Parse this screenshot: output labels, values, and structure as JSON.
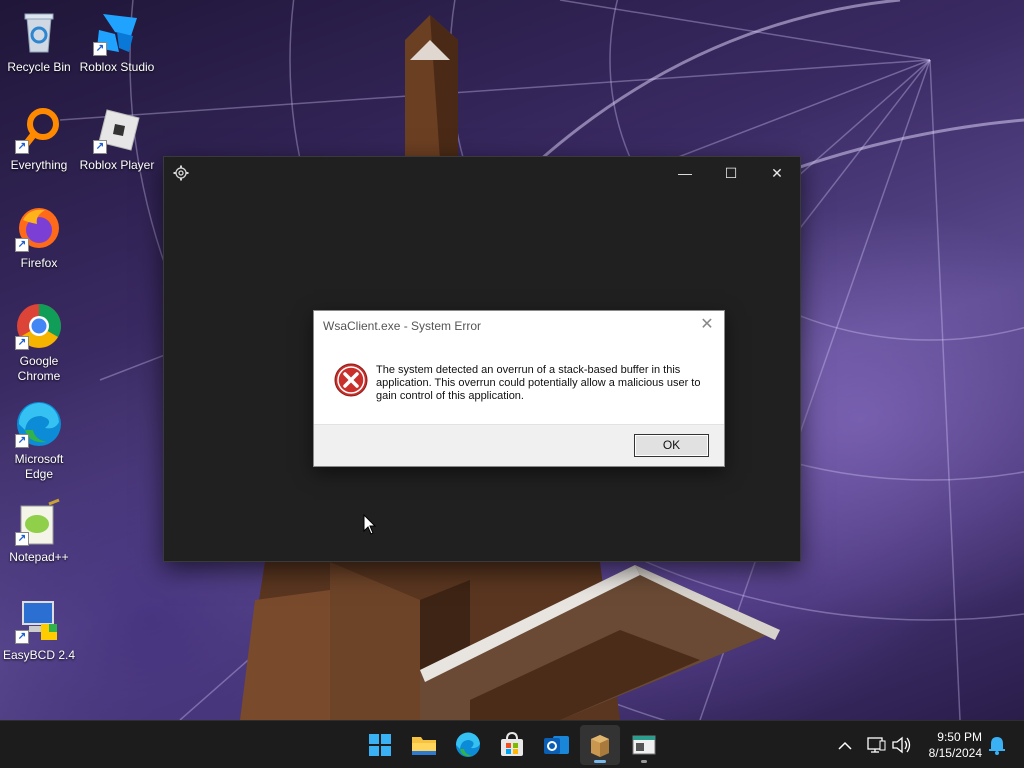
{
  "desktop": {
    "icons": [
      {
        "label": "Recycle Bin",
        "icon": "recycle-bin-icon"
      },
      {
        "label": "Roblox Studio",
        "icon": "roblox-studio-icon"
      },
      {
        "label": "Everything",
        "icon": "everything-search-icon"
      },
      {
        "label": "Roblox Player",
        "icon": "roblox-player-icon"
      },
      {
        "label": "Firefox",
        "icon": "firefox-icon"
      },
      {
        "label": "Google Chrome",
        "icon": "chrome-icon"
      },
      {
        "label": "Microsoft Edge",
        "icon": "edge-icon"
      },
      {
        "label": "Notepad++",
        "icon": "notepad-plus-plus-icon"
      },
      {
        "label": "EasyBCD 2.4",
        "icon": "easybcd-icon"
      }
    ]
  },
  "app_window": {
    "controls": {
      "minimize": "—",
      "maximize": "☐",
      "close": "✕"
    },
    "settings_icon": "gear-icon"
  },
  "dialog": {
    "title": "WsaClient.exe - System Error",
    "close": "✕",
    "message": "The system detected an overrun of a stack-based buffer in this application. This overrun could potentially allow a malicious user to gain control of this application.",
    "ok_label": "OK",
    "icon": "error-icon"
  },
  "taskbar": {
    "apps": [
      {
        "name": "Start",
        "icon": "windows-start-icon"
      },
      {
        "name": "File Explorer",
        "icon": "file-explorer-icon"
      },
      {
        "name": "Microsoft Edge",
        "icon": "edge-icon"
      },
      {
        "name": "Microsoft Store",
        "icon": "store-icon"
      },
      {
        "name": "Outlook",
        "icon": "outlook-icon"
      },
      {
        "name": "Windows Subsystem for Android",
        "icon": "package-icon"
      },
      {
        "name": "Desktop app",
        "icon": "app-window-icon"
      }
    ],
    "tray": {
      "time": "9:50 PM",
      "date": "8/15/2024"
    }
  },
  "colors": {
    "accent": "#76b9ed",
    "error_red": "#c9302c",
    "taskbar": "#1c1c1c",
    "app_window": "#202020"
  }
}
